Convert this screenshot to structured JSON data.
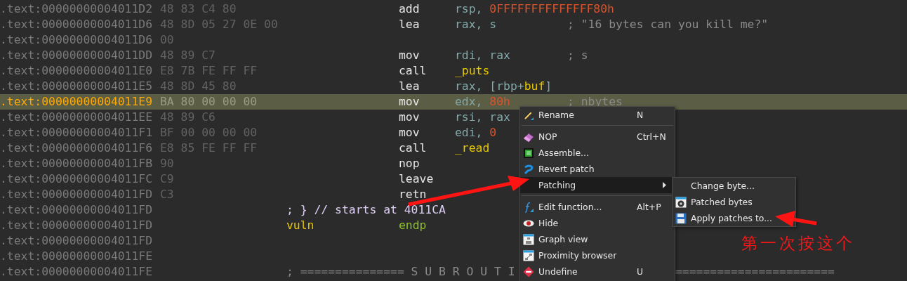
{
  "listing": {
    "rows": [
      {
        "kind": "instruction",
        "address": ".text:00000000004011D2",
        "bytes": "48 83 C4 80",
        "mnemonic": "add",
        "operands": [
          {
            "text": "rsp, ",
            "kind": "reg"
          },
          {
            "text": "0FFFFFFFFFFFFFF80h",
            "kind": "num"
          }
        ],
        "selected": false
      },
      {
        "kind": "instruction",
        "address": ".text:00000000004011D6",
        "bytes": "48 8D 05 27 0E 00",
        "mnemonic": "lea",
        "operands": [
          {
            "text": "rax, s",
            "kind": "reg"
          }
        ],
        "comment": "; \"16 bytes can you kill me?\"",
        "selected": false
      },
      {
        "kind": "instruction",
        "address": ".text:00000000004011D6",
        "bytes": "00",
        "selected": false
      },
      {
        "kind": "instruction",
        "address": ".text:00000000004011DD",
        "bytes": "48 89 C7",
        "mnemonic": "mov",
        "operands": [
          {
            "text": "rdi, rax",
            "kind": "reg"
          }
        ],
        "comment": "; s",
        "selected": false
      },
      {
        "kind": "instruction",
        "address": ".text:00000000004011E0",
        "bytes": "E8 7B FE FF FF",
        "mnemonic": "call",
        "operands": [
          {
            "text": "_puts",
            "kind": "name"
          }
        ],
        "selected": false
      },
      {
        "kind": "instruction",
        "address": ".text:00000000004011E5",
        "bytes": "48 8D 45 80",
        "mnemonic": "lea",
        "operands": [
          {
            "text": "rax, [rbp+",
            "kind": "reg"
          },
          {
            "text": "buf",
            "kind": "name"
          },
          {
            "text": "]",
            "kind": "reg"
          }
        ],
        "selected": false
      },
      {
        "kind": "instruction",
        "address": ".text:00000000004011E9",
        "bytes": "BA 80 00 00 00",
        "mnemonic": "mov",
        "operands": [
          {
            "text": "edx, ",
            "kind": "reg"
          },
          {
            "text": "80h",
            "kind": "num"
          }
        ],
        "comment": "; nbytes",
        "selected": true
      },
      {
        "kind": "instruction",
        "address": ".text:00000000004011EE",
        "bytes": "48 89 C6",
        "mnemonic": "mov",
        "operands": [
          {
            "text": "rsi, rax",
            "kind": "reg"
          }
        ],
        "selected": false
      },
      {
        "kind": "instruction",
        "address": ".text:00000000004011F1",
        "bytes": "BF 00 00 00 00",
        "mnemonic": "mov",
        "operands": [
          {
            "text": "edi, ",
            "kind": "reg"
          },
          {
            "text": "0",
            "kind": "num"
          }
        ],
        "selected": false
      },
      {
        "kind": "instruction",
        "address": ".text:00000000004011F6",
        "bytes": "E8 85 FE FF FF",
        "mnemonic": "call",
        "operands": [
          {
            "text": "_read",
            "kind": "name"
          }
        ],
        "selected": false
      },
      {
        "kind": "instruction",
        "address": ".text:00000000004011FB",
        "bytes": "90",
        "mnemonic": "nop",
        "selected": false
      },
      {
        "kind": "instruction",
        "address": ".text:00000000004011FC",
        "bytes": "C9",
        "mnemonic": "leave",
        "selected": false
      },
      {
        "kind": "instruction",
        "address": ".text:00000000004011FD",
        "bytes": "C3",
        "mnemonic": "retn",
        "selected": false
      },
      {
        "kind": "comment",
        "address": ".text:00000000004011FD",
        "label": "; } // starts at 4011CA",
        "selected": false
      },
      {
        "kind": "proc_end",
        "address": ".text:00000000004011FD",
        "label": "vuln",
        "mnemonic": "endp",
        "selected": false
      },
      {
        "kind": "blank",
        "address": ".text:00000000004011FD",
        "selected": false
      },
      {
        "kind": "blank",
        "address": ".text:00000000004011FE",
        "selected": false
      },
      {
        "kind": "separator",
        "address": ".text:00000000004011FE",
        "label": "; =============== S U B R O U T I",
        "tail": "=======================",
        "selected": false
      }
    ]
  },
  "context_menu": {
    "items": [
      {
        "kind": "item",
        "label": "Rename",
        "shortcut": "N",
        "selected": false
      },
      {
        "kind": "separator"
      },
      {
        "kind": "item",
        "label": "NOP",
        "shortcut": "Ctrl+N",
        "selected": false
      },
      {
        "kind": "item",
        "label": "Assemble...",
        "selected": false
      },
      {
        "kind": "item",
        "label": "Revert patch",
        "selected": false
      },
      {
        "kind": "submenu",
        "label": "Patching",
        "selected": true
      },
      {
        "kind": "separator"
      },
      {
        "kind": "item",
        "label": "Edit function...",
        "shortcut": "Alt+P",
        "selected": false
      },
      {
        "kind": "item",
        "label": "Hide",
        "selected": false
      },
      {
        "kind": "item",
        "label": "Graph view",
        "selected": false
      },
      {
        "kind": "item",
        "label": "Proximity browser",
        "selected": false
      },
      {
        "kind": "item",
        "label": "Undefine",
        "shortcut": "U",
        "selected": false
      }
    ]
  },
  "submenu": {
    "items": [
      {
        "kind": "item",
        "label": "Change byte...",
        "selected": false
      },
      {
        "kind": "item",
        "label": "Patched bytes",
        "selected": false
      },
      {
        "kind": "item",
        "label": "Apply patches to...",
        "selected": false
      }
    ]
  },
  "annotation": {
    "note": "第一次按这个"
  }
}
